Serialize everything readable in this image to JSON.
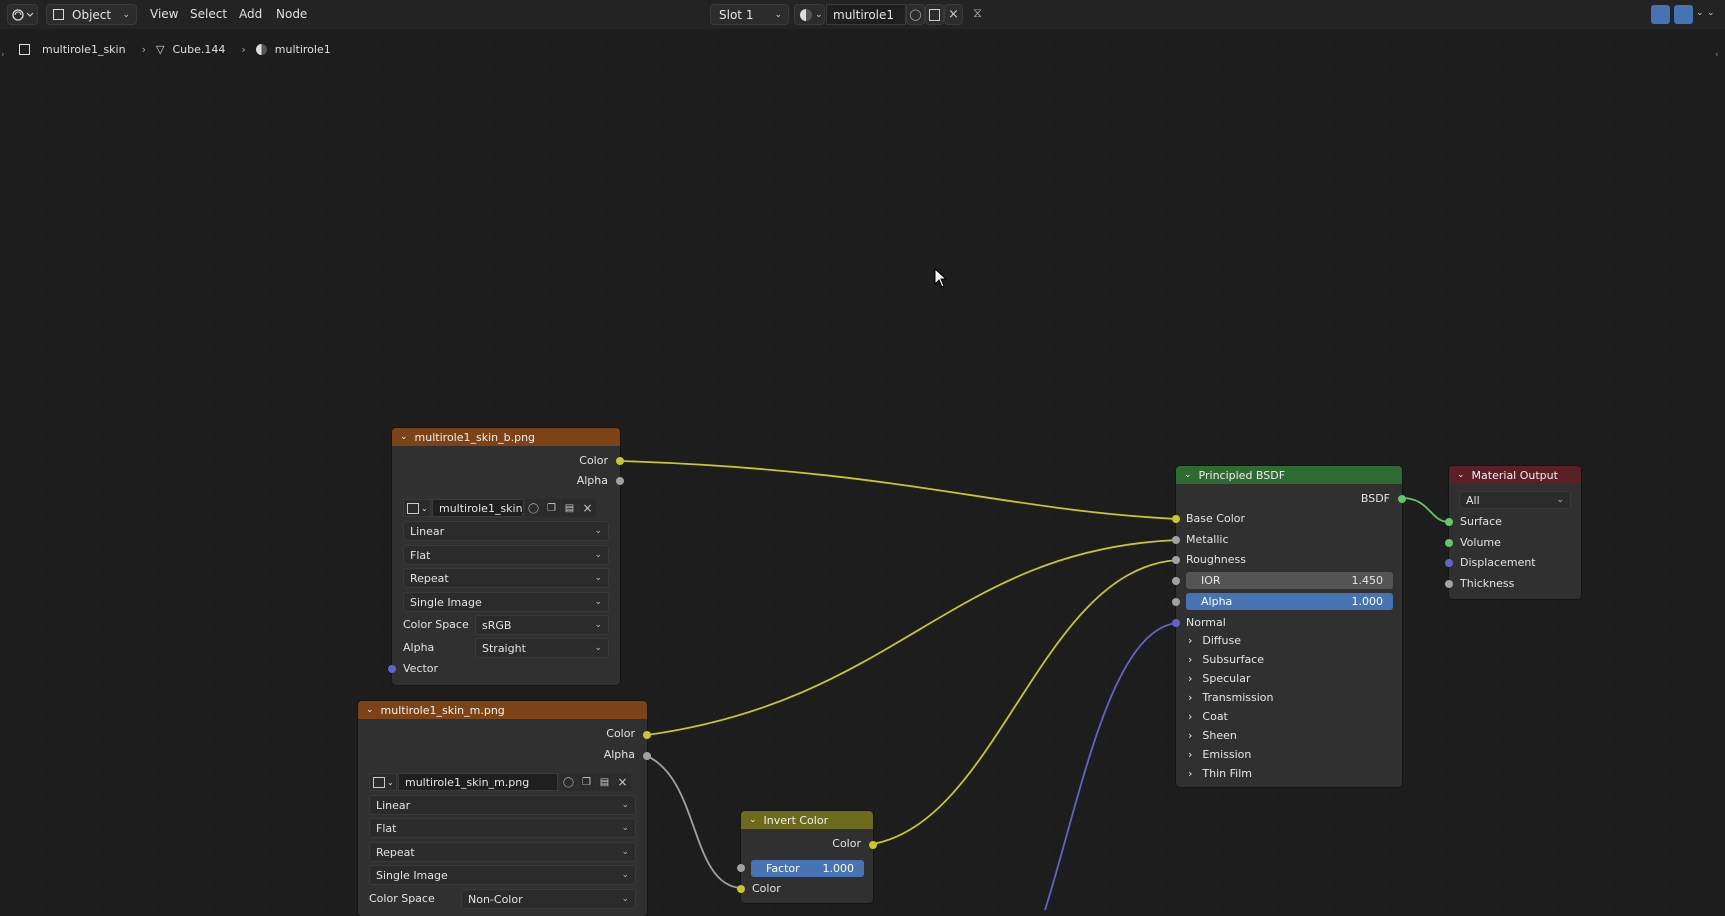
{
  "topbar": {
    "mode": "Object",
    "menus": [
      "View",
      "Select",
      "Add",
      "Node"
    ],
    "slot": "Slot 1",
    "material": "multirole1"
  },
  "breadcrumb": {
    "object": "multirole1_skin",
    "mesh": "Cube.144",
    "material": "multirole1"
  },
  "image_node_b": {
    "title": "multirole1_skin_b.png",
    "out_color": "Color",
    "out_alpha": "Alpha",
    "image_name": "multirole1_skin_...",
    "interpolation": "Linear",
    "projection": "Flat",
    "extension": "Repeat",
    "source": "Single Image",
    "colorspace_label": "Color Space",
    "colorspace": "sRGB",
    "alpha_label": "Alpha",
    "alpha_mode": "Straight",
    "in_vector": "Vector"
  },
  "image_node_m": {
    "title": "multirole1_skin_m.png",
    "out_color": "Color",
    "out_alpha": "Alpha",
    "image_name": "multirole1_skin_m.png",
    "interpolation": "Linear",
    "projection": "Flat",
    "extension": "Repeat",
    "source": "Single Image",
    "colorspace_label": "Color Space",
    "colorspace": "Non-Color"
  },
  "invert_node": {
    "title": "Invert Color",
    "out_color": "Color",
    "factor_label": "Factor",
    "factor_value": "1.000",
    "in_color": "Color"
  },
  "bsdf_node": {
    "title": "Principled BSDF",
    "out": "BSDF",
    "base_color": "Base Color",
    "metallic": "Metallic",
    "roughness": "Roughness",
    "ior_label": "IOR",
    "ior_value": "1.450",
    "alpha_label": "Alpha",
    "alpha_value": "1.000",
    "normal": "Normal",
    "panels": [
      "Diffuse",
      "Subsurface",
      "Specular",
      "Transmission",
      "Coat",
      "Sheen",
      "Emission",
      "Thin Film"
    ]
  },
  "output_node": {
    "title": "Material Output",
    "target": "All",
    "inputs": [
      "Surface",
      "Volume",
      "Displacement",
      "Thickness"
    ]
  },
  "colors": {
    "image_header": "#7c4317",
    "bsdf_header": "#2e6a31",
    "output_header": "#5a1f27",
    "invert_header": "#6b6a1d",
    "socket_color": "#c7c729",
    "socket_gray": "#a1a1a1",
    "socket_vector": "#6363c7",
    "socket_shader": "#63c763",
    "slider_blue": "#4772b3"
  }
}
